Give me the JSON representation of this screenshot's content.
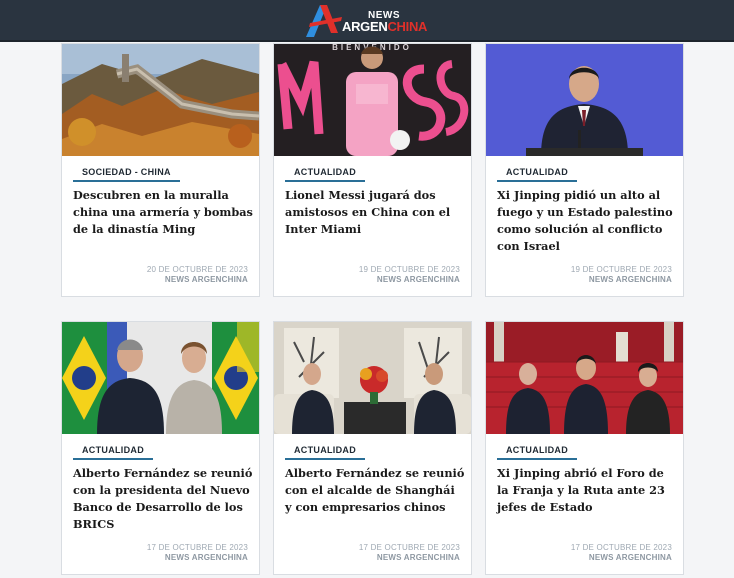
{
  "header": {
    "logo_news": "NEWS",
    "logo_brand_1": "ARGEN",
    "logo_brand_2": "CHINA"
  },
  "cards": [
    {
      "tag": "SOCIEDAD - CHINA",
      "title": "Descubren en la muralla china una armería y bombas de la dinastía Ming",
      "date": "20 DE OCTUBRE DE 2023",
      "author": "NEWS ARGENCHINA",
      "image": "great-wall-photo"
    },
    {
      "tag": "ACTUALIDAD",
      "title": "Lionel Messi jugará dos amistosos en China con el Inter Miami",
      "date": "19 DE OCTUBRE DE 2023",
      "author": "NEWS ARGENCHINA",
      "image": "messi-inter-miami-photo",
      "image_text": "BIENVENIDO"
    },
    {
      "tag": "ACTUALIDAD",
      "title": "Xi Jinping pidió un alto al fuego y un Estado palestino como solución al conflicto con Israel",
      "date": "19 DE OCTUBRE DE 2023",
      "author": "NEWS ARGENCHINA",
      "image": "xi-jinping-podium-photo"
    },
    {
      "tag": "ACTUALIDAD",
      "title": "Alberto Fernández se reunió con la presidenta del Nuevo Banco de Desarrollo de los BRICS",
      "date": "17 DE OCTUBRE DE 2023",
      "author": "NEWS ARGENCHINA",
      "image": "fernandez-rousseff-photo"
    },
    {
      "tag": "ACTUALIDAD",
      "title": "Alberto Fernández se reunió con el alcalde de Shanghái y con empresarios chinos",
      "date": "17 DE OCTUBRE DE 2023",
      "author": "NEWS ARGENCHINA",
      "image": "shanghai-meeting-photo"
    },
    {
      "tag": "ACTUALIDAD",
      "title": "Xi Jinping abrió el Foro de la Franja y la Ruta ante 23 jefes de Estado",
      "date": "17 DE OCTUBRE DE 2023",
      "author": "NEWS ARGENCHINA",
      "image": "belt-road-forum-photo"
    }
  ]
}
